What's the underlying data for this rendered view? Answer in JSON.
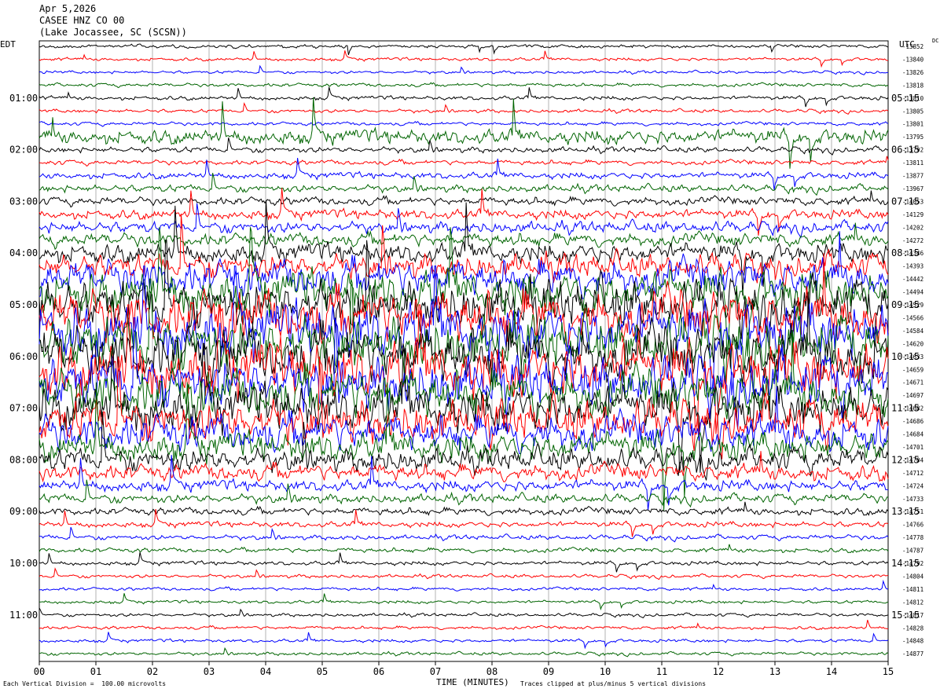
{
  "header": {
    "date": "Apr 5,2026",
    "station": "CASEE HNZ CO 00",
    "location": "(Lake Jocassee, SC (SCSN))"
  },
  "left_timezone": "EDT",
  "right_timezone": "UTC",
  "corner_mark": "DC",
  "footer": {
    "scale": "Each Vertical Division =  100.00 microvolts",
    "xlabel": "TIME (MINUTES)",
    "clip": "Traces clipped at plus/minus 5 vertical divisions"
  },
  "colors": {
    "trace_cycle": [
      "#000000",
      "#ff0000",
      "#0000ff",
      "#006400"
    ],
    "grid": "#808080"
  },
  "chart_data": {
    "type": "line",
    "title": "",
    "xlabel": "TIME (MINUTES)",
    "ylabel": "",
    "xlim": [
      0,
      15
    ],
    "x_ticks": [
      "00",
      "01",
      "02",
      "03",
      "04",
      "05",
      "06",
      "07",
      "08",
      "09",
      "10",
      "11",
      "12",
      "13",
      "14",
      "15"
    ],
    "trace_count": 48,
    "left_hour_labels": [
      "01:00",
      "02:00",
      "03:00",
      "04:00",
      "05:00",
      "06:00",
      "07:00",
      "08:00",
      "09:00",
      "10:00",
      "11:00"
    ],
    "right_hour_labels": [
      "05:15",
      "06:15",
      "07:15",
      "08:15",
      "09:15",
      "10:15",
      "11:15",
      "12:15",
      "13:15",
      "14:15",
      "15:15"
    ],
    "trace_offsets": [
      -13852,
      -13840,
      -13826,
      -13818,
      -13810,
      -13805,
      -13801,
      -13795,
      -13792,
      -13811,
      -13877,
      -13967,
      -14053,
      -14129,
      -14202,
      -14272,
      -14346,
      -14393,
      -14442,
      -14494,
      -14529,
      -14566,
      -14584,
      -14620,
      -14633,
      -14659,
      -14671,
      -14697,
      -14682,
      -14686,
      -14684,
      -14701,
      -14704,
      -14712,
      -14724,
      -14733,
      -14751,
      -14766,
      -14778,
      -14787,
      -14792,
      -14804,
      -14811,
      -14812,
      -14817,
      -14828,
      -14848,
      -14877
    ],
    "trace_amplitudes": [
      0.2,
      0.2,
      0.18,
      0.22,
      0.25,
      0.22,
      0.22,
      0.9,
      0.35,
      0.3,
      0.4,
      0.45,
      0.5,
      0.6,
      0.7,
      0.8,
      1.2,
      1.5,
      2.2,
      2.6,
      3.0,
      3.2,
      3.4,
      3.4,
      3.4,
      3.4,
      3.2,
      3.0,
      2.8,
      2.6,
      2.2,
      1.8,
      1.4,
      1.0,
      0.7,
      0.55,
      0.45,
      0.35,
      0.3,
      0.28,
      0.25,
      0.22,
      0.2,
      0.2,
      0.2,
      0.2,
      0.2,
      0.2
    ]
  }
}
